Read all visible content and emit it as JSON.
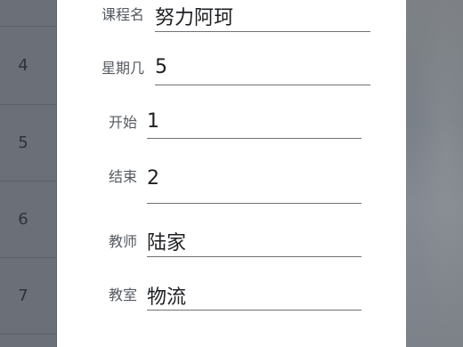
{
  "timetable": {
    "periods": [
      "4",
      "5",
      "6",
      "7"
    ]
  },
  "dialog": {
    "fields": [
      {
        "label": "课程名",
        "value": "努力阿珂"
      },
      {
        "label": "星期几",
        "value": "5"
      },
      {
        "label": "开始",
        "value": "1"
      },
      {
        "label": "结束",
        "value": "2"
      },
      {
        "label": "教师",
        "value": "陆家"
      },
      {
        "label": "教室",
        "value": "物流"
      }
    ]
  }
}
